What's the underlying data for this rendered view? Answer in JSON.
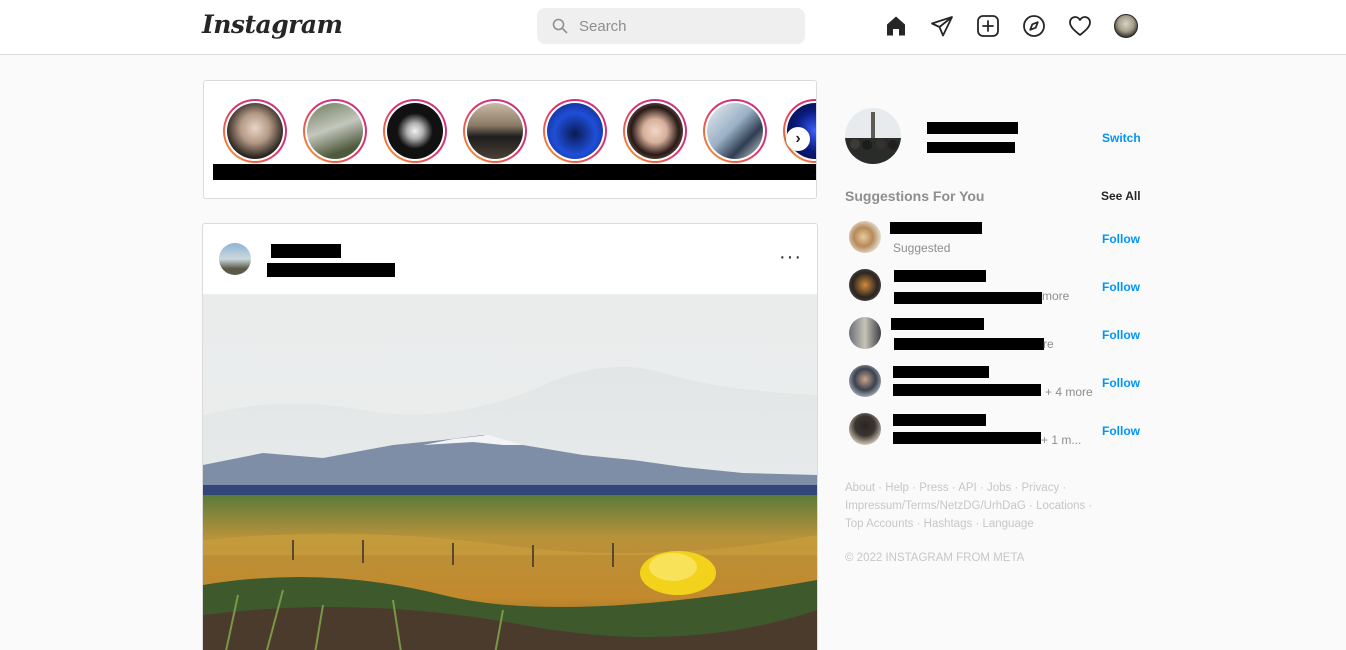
{
  "header": {
    "logo": "Instagram",
    "search": {
      "placeholder": "Search",
      "value": ""
    },
    "nav_icons": [
      "home-icon",
      "direct-message-icon",
      "new-post-icon",
      "explore-icon",
      "activity-heart-icon",
      "profile-avatar"
    ]
  },
  "stories": {
    "count_visible": 8,
    "next_icon": "chevron-right-icon"
  },
  "post": {
    "more_label": "···"
  },
  "sidebar": {
    "switch_label": "Switch",
    "suggestions_title": "Suggestions For You",
    "see_all_label": "See All",
    "suggestions": [
      {
        "subtitle": "Suggested",
        "follow_label": "Follow"
      },
      {
        "subtitle": "more",
        "follow_label": "Follow"
      },
      {
        "subtitle": "re",
        "follow_label": "Follow"
      },
      {
        "subtitle": "+ 4 more",
        "follow_label": "Follow"
      },
      {
        "subtitle": "+ 1 m...",
        "follow_label": "Follow"
      }
    ],
    "footer_links": [
      "About",
      "Help",
      "Press",
      "API",
      "Jobs",
      "Privacy",
      "Impressum/Terms/NetzDG/UrhDaG",
      "Locations",
      "Top Accounts",
      "Hashtags",
      "Language"
    ],
    "copyright": "© 2022 INSTAGRAM FROM META"
  },
  "colors": {
    "accent": "#0095f6",
    "story_ring_start": "#f5a623",
    "story_ring_end": "#c13584",
    "border": "#dbdbdb"
  }
}
